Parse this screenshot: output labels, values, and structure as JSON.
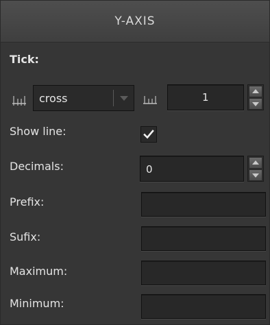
{
  "panel": {
    "title": "Y-AXIS"
  },
  "tick": {
    "section_label": "Tick:",
    "type_icon": "tick-marks-icon",
    "type_value": "cross",
    "interval_icon": "tick-interval-icon",
    "interval_value": "1"
  },
  "show_line": {
    "label": "Show line:",
    "checked": true
  },
  "decimals": {
    "label": "Decimals:",
    "value": "0"
  },
  "prefix": {
    "label": "Prefix:",
    "value": ""
  },
  "suffix": {
    "label": "Sufix:",
    "value": ""
  },
  "maximum": {
    "label": "Maximum:",
    "value": ""
  },
  "minimum": {
    "label": "Minimum:",
    "value": ""
  }
}
